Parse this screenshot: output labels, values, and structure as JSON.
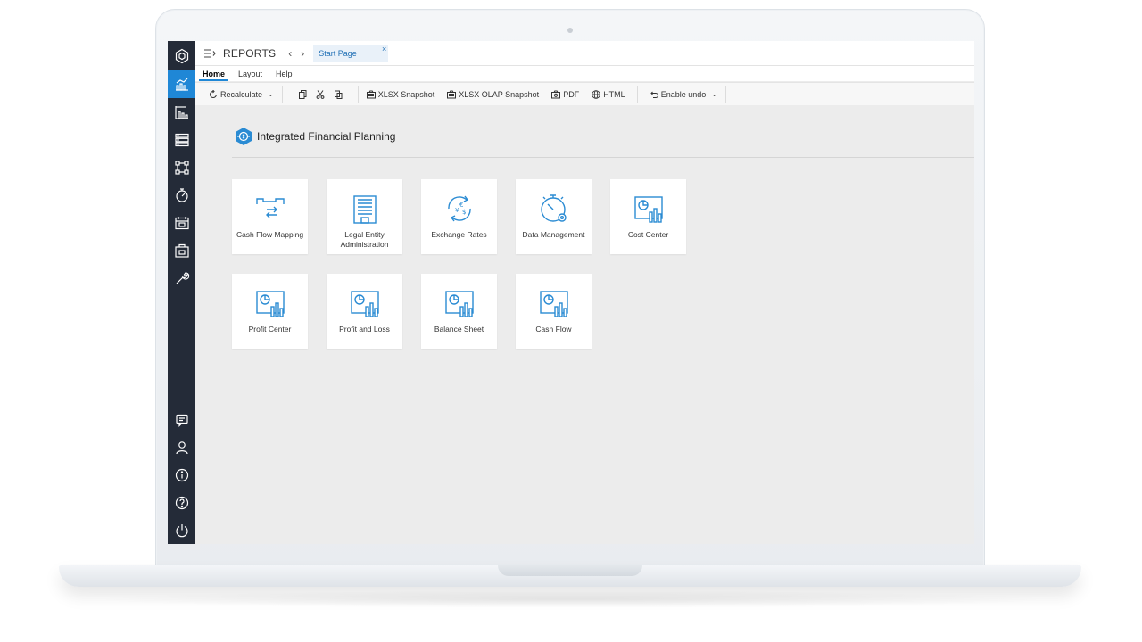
{
  "app": {
    "title": "REPORTS",
    "back_glyph": "‹",
    "forward_glyph": "›",
    "tab": {
      "label": "Start Page",
      "close_glyph": "×"
    }
  },
  "ribbon_tabs": [
    {
      "label": "Home",
      "active": true
    },
    {
      "label": "Layout",
      "active": false
    },
    {
      "label": "Help",
      "active": false
    }
  ],
  "toolbar": {
    "recalculate": "Recalculate",
    "xlsx_snapshot": "XLSX Snapshot",
    "xlsx_olap_snapshot": "XLSX OLAP Snapshot",
    "pdf": "PDF",
    "html": "HTML",
    "enable_undo": "Enable undo",
    "caret_glyph": "⌄"
  },
  "section": {
    "title": "Integrated Financial Planning"
  },
  "tiles": [
    {
      "label": "Cash Flow Mapping",
      "icon": "cash-flow-mapping-icon"
    },
    {
      "label": "Legal Entity Administration",
      "icon": "building-icon"
    },
    {
      "label": "Exchange Rates",
      "icon": "currency-exchange-icon"
    },
    {
      "label": "Data Management",
      "icon": "stopwatch-gear-icon"
    },
    {
      "label": "Cost Center",
      "icon": "report-chart-icon"
    },
    {
      "label": "Profit Center",
      "icon": "report-chart-icon"
    },
    {
      "label": "Profit and Loss",
      "icon": "report-chart-icon"
    },
    {
      "label": "Balance Sheet",
      "icon": "report-chart-icon"
    },
    {
      "label": "Cash Flow",
      "icon": "report-chart-icon"
    }
  ],
  "colors": {
    "accent": "#1f87d6",
    "sidebar": "#242b38",
    "icon_blue": "#2a8bd3"
  },
  "sidebar_icons": [
    "logo-hexagon-icon",
    "reports-chart-icon",
    "gauge-bars-icon",
    "server-icon",
    "hierarchy-icon",
    "timer-icon",
    "calendar-icon",
    "briefcase-icon",
    "wrench-icon",
    "chat-icon",
    "user-icon",
    "info-icon",
    "help-icon",
    "power-icon"
  ]
}
